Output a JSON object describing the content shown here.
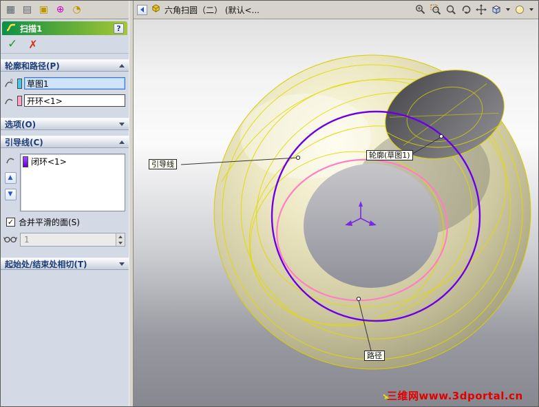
{
  "icons": {
    "sketch_grid": "▦",
    "annotations": "▤",
    "property_tab": "▣",
    "move_rotate": "⊕",
    "mass_props": "◔",
    "help": "?",
    "up_arrow": "▲",
    "down_arrow": "▼",
    "check": "✓"
  },
  "property_manager": {
    "title": "扫描1",
    "ok": "✓",
    "cancel": "✗",
    "groups": {
      "profile_path": {
        "label": "轮廓和路径(P)",
        "profile_value": "草图1",
        "path_value": "开环<1>"
      },
      "options": {
        "label": "选项(O)"
      },
      "guides": {
        "label": "引导线(C)",
        "item": "闭环<1>",
        "merge_label": "合并平滑的面(S)",
        "spinner_value": "1"
      },
      "tangency": {
        "label": "起始处/结束处相切(T)"
      }
    }
  },
  "titlebar": {
    "document": "六角扫圆（二） (默认<..."
  },
  "viewport": {
    "callout_guide": "引导线",
    "callout_profile": "轮廓(草图1)",
    "callout_path": "路径",
    "watermark": "三维网www.3dportal.cn"
  },
  "colors": {
    "guide_curve": "#6a00e8",
    "path_curve": "#ff7fc2",
    "wireframe_yellow": "#e2da00",
    "watermark_red": "#e10000",
    "header_green": "#0b9148"
  }
}
